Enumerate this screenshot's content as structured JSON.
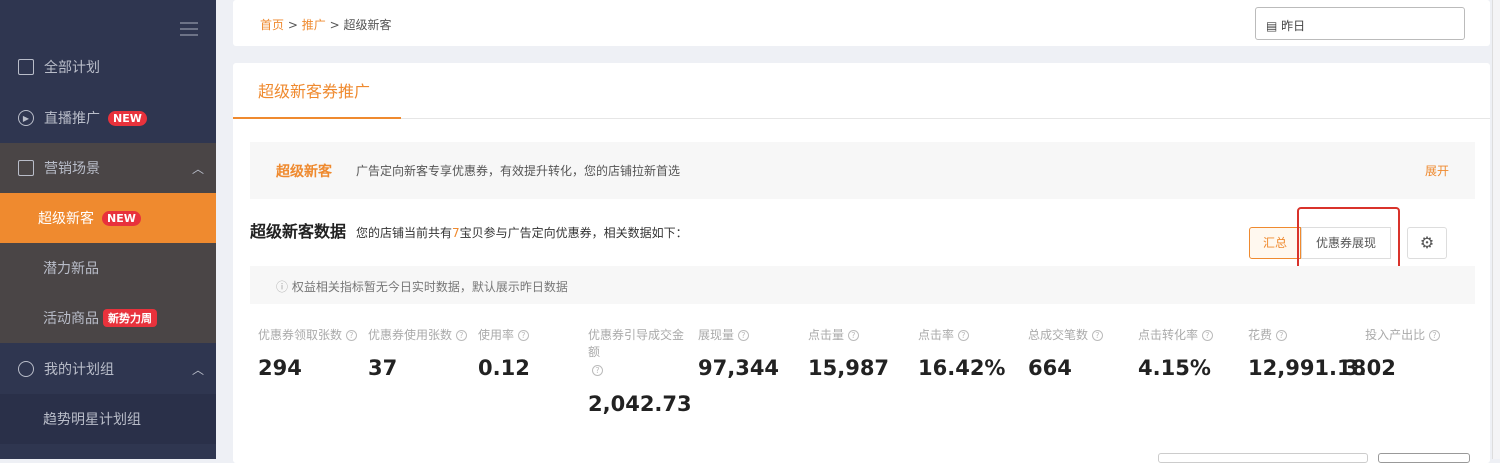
{
  "sidebar": {
    "items": [
      {
        "label": "全部计划"
      },
      {
        "label": "直播推广",
        "badge": "NEW"
      },
      {
        "label": "营销场景"
      },
      {
        "label": "超级新客",
        "badge": "NEW"
      },
      {
        "label": "潜力新品"
      },
      {
        "label": "活动商品",
        "badge": "新势力周"
      },
      {
        "label": "我的计划组"
      },
      {
        "label": "趋势明星计划组"
      }
    ]
  },
  "breadcrumb": [
    "首页",
    ">",
    "推广",
    ">",
    "超级新客"
  ],
  "date_picker": {
    "value": "昨日"
  },
  "tab": "超级新客券推广",
  "banner": {
    "title": "超级新客",
    "desc": "广告定向新客专享优惠券，有效提升转化，您的店铺拉新首选",
    "expand": "展开"
  },
  "section": {
    "title": "超级新客数据",
    "desc_pre": "您的店铺当前共有",
    "count": "7",
    "desc_post": "宝贝参与广告定向优惠券，相关数据如下：",
    "notice": "权益相关指标暂无今日实时数据，默认展示昨日数据"
  },
  "buttons": {
    "summary": "汇总",
    "coupon_display": "优惠券展现"
  },
  "metrics": [
    {
      "label": "优惠券领取张数",
      "value": "294"
    },
    {
      "label": "优惠券使用张数",
      "value": "37"
    },
    {
      "label": "使用率",
      "value": "0.12"
    },
    {
      "label": "优惠券引导成交金额",
      "value": "2,042.73"
    },
    {
      "label": "展现量",
      "value": "97,344"
    },
    {
      "label": "点击量",
      "value": "15,987"
    },
    {
      "label": "点击率",
      "value": "16.42%"
    },
    {
      "label": "总成交笔数",
      "value": "664"
    },
    {
      "label": "点击转化率",
      "value": "4.15%"
    },
    {
      "label": "花费",
      "value": "12,991.18"
    },
    {
      "label": "投入产出比",
      "value": "3.02"
    }
  ],
  "colors": {
    "accent": "#ef8a2f",
    "sidebar": "#2f3650",
    "badge": "#e8323c"
  }
}
